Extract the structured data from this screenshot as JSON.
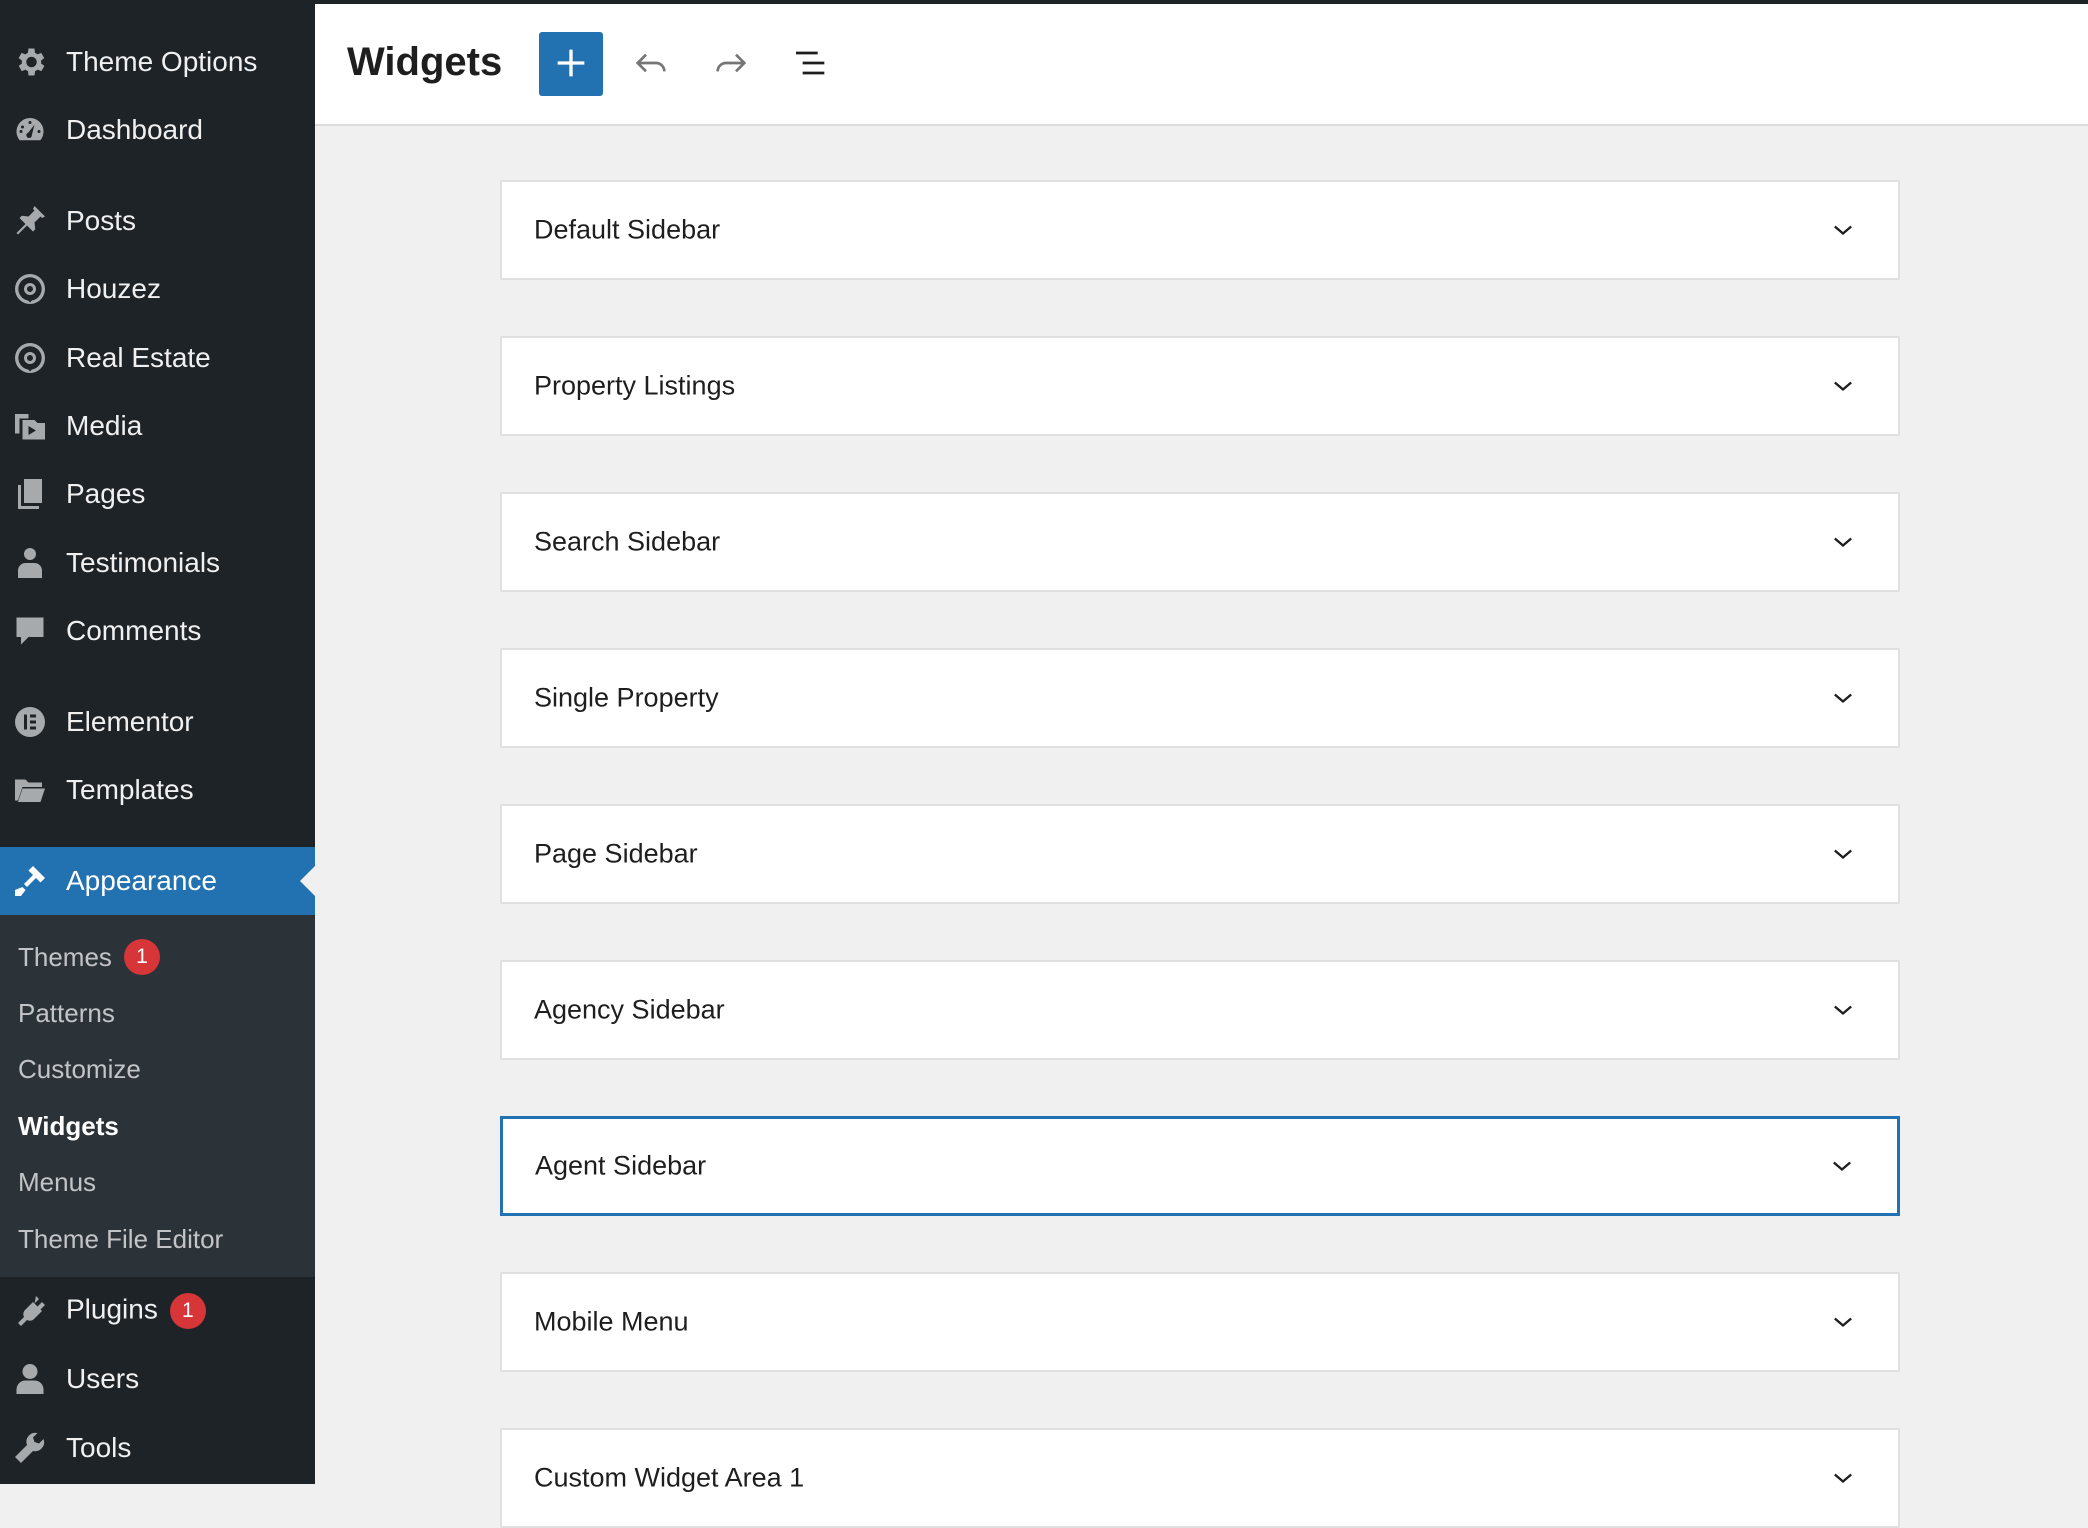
{
  "sidebar": {
    "items": [
      {
        "label": "Theme Options",
        "icon": "gear-icon"
      },
      {
        "label": "Dashboard",
        "icon": "dashboard-icon"
      },
      {
        "label": "Posts",
        "icon": "pin-icon"
      },
      {
        "label": "Houzez",
        "icon": "location-pin-icon"
      },
      {
        "label": "Real Estate",
        "icon": "location-pin-icon"
      },
      {
        "label": "Media",
        "icon": "media-icon"
      },
      {
        "label": "Pages",
        "icon": "pages-icon"
      },
      {
        "label": "Testimonials",
        "icon": "user-badge-icon"
      },
      {
        "label": "Comments",
        "icon": "speech-bubble-icon"
      },
      {
        "label": "Elementor",
        "icon": "elementor-icon"
      },
      {
        "label": "Templates",
        "icon": "folder-icon"
      },
      {
        "label": "Appearance",
        "icon": "paintbrush-icon"
      },
      {
        "label": "Plugins",
        "icon": "plug-icon",
        "badge": "1"
      },
      {
        "label": "Users",
        "icon": "user-icon"
      },
      {
        "label": "Tools",
        "icon": "wrench-icon"
      }
    ],
    "submenu": [
      {
        "label": "Themes",
        "badge": "1"
      },
      {
        "label": "Patterns"
      },
      {
        "label": "Customize"
      },
      {
        "label": "Widgets"
      },
      {
        "label": "Menus"
      },
      {
        "label": "Theme File Editor"
      }
    ],
    "active_item": "Appearance",
    "current_subitem": "Widgets"
  },
  "header": {
    "title": "Widgets",
    "buttons": [
      "add-block-icon",
      "undo-icon",
      "redo-icon",
      "list-view-icon"
    ]
  },
  "widget_areas": [
    {
      "title": "Default Sidebar"
    },
    {
      "title": "Property Listings"
    },
    {
      "title": "Search Sidebar"
    },
    {
      "title": "Single Property"
    },
    {
      "title": "Page Sidebar"
    },
    {
      "title": "Agency Sidebar"
    },
    {
      "title": "Agent Sidebar"
    },
    {
      "title": "Mobile Menu"
    },
    {
      "title": "Custom Widget Area 1"
    }
  ],
  "focused_area": "Agent Sidebar",
  "colors": {
    "sidebar_bg": "#1d2327",
    "submenu_bg": "#2c3338",
    "accent": "#2271b1",
    "badge": "#d63638",
    "content_bg": "#f0f0f1"
  }
}
